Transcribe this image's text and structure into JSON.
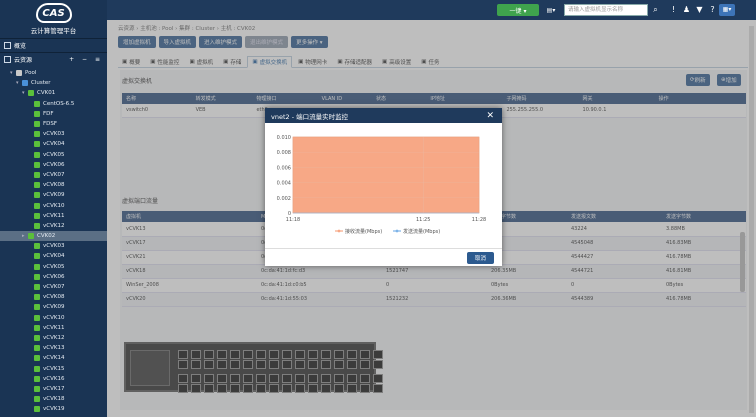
{
  "app": {
    "title": "云计算管理平台",
    "logo": "CAS"
  },
  "nav": {
    "overview": "概览",
    "resources": "云资源",
    "tools": "+ − ≡"
  },
  "tree": [
    {
      "label": "Pool",
      "level": 1,
      "type": "pool",
      "arrow": "▾"
    },
    {
      "label": "Cluster",
      "level": 2,
      "type": "cluster",
      "arrow": "▾"
    },
    {
      "label": "CVK01",
      "level": 3,
      "type": "host",
      "arrow": "▾"
    },
    {
      "label": "CentOS-6.5",
      "level": 4,
      "type": "vm"
    },
    {
      "label": "FDF",
      "level": 4,
      "type": "vm"
    },
    {
      "label": "FDSF",
      "level": 4,
      "type": "vm"
    },
    {
      "label": "vCVK03",
      "level": 4,
      "type": "vm"
    },
    {
      "label": "vCVK04",
      "level": 4,
      "type": "vm"
    },
    {
      "label": "vCVK05",
      "level": 4,
      "type": "vm"
    },
    {
      "label": "vCVK06",
      "level": 4,
      "type": "vm"
    },
    {
      "label": "vCVK07",
      "level": 4,
      "type": "vm"
    },
    {
      "label": "vCVK08",
      "level": 4,
      "type": "vm"
    },
    {
      "label": "vCVK09",
      "level": 4,
      "type": "vm"
    },
    {
      "label": "vCVK10",
      "level": 4,
      "type": "vm"
    },
    {
      "label": "vCVK11",
      "level": 4,
      "type": "vm"
    },
    {
      "label": "vCVK12",
      "level": 4,
      "type": "vm"
    },
    {
      "label": "CVK02",
      "level": 3,
      "type": "host",
      "arrow": "▸",
      "selected": true
    },
    {
      "label": "vCVK03",
      "level": 4,
      "type": "vm"
    },
    {
      "label": "vCVK04",
      "level": 4,
      "type": "vm"
    },
    {
      "label": "vCVK05",
      "level": 4,
      "type": "vm"
    },
    {
      "label": "vCVK06",
      "level": 4,
      "type": "vm"
    },
    {
      "label": "vCVK07",
      "level": 4,
      "type": "vm"
    },
    {
      "label": "vCVK08",
      "level": 4,
      "type": "vm"
    },
    {
      "label": "vCVK09",
      "level": 4,
      "type": "vm"
    },
    {
      "label": "vCVK10",
      "level": 4,
      "type": "vm"
    },
    {
      "label": "vCVK11",
      "level": 4,
      "type": "vm"
    },
    {
      "label": "vCVK12",
      "level": 4,
      "type": "vm"
    },
    {
      "label": "vCVK13",
      "level": 4,
      "type": "vm"
    },
    {
      "label": "vCVK14",
      "level": 4,
      "type": "vm"
    },
    {
      "label": "vCVK15",
      "level": 4,
      "type": "vm"
    },
    {
      "label": "vCVK16",
      "level": 4,
      "type": "vm"
    },
    {
      "label": "vCVK17",
      "level": 4,
      "type": "vm"
    },
    {
      "label": "vCVK18",
      "level": 4,
      "type": "vm"
    },
    {
      "label": "vCVK19",
      "level": 4,
      "type": "vm"
    }
  ],
  "topbar": {
    "green_btn": "一键 ▾",
    "search_placeholder": "请输入虚拟机显示名称"
  },
  "breadcrumb": "云资源 › 主机池 : Pool › 集群 : Cluster › 主机 : CVK02",
  "toolbar": [
    "增加虚拟机",
    "导入虚拟机",
    "进入维护模式",
    "退出维护模式",
    "更多操作 ▾"
  ],
  "tabs": [
    "概要",
    "性能监控",
    "虚拟机",
    "存储",
    "虚拟交换机",
    "物理网卡",
    "存储适配器",
    "高级设置",
    "任务"
  ],
  "vswitch": {
    "title": "虚拟交换机",
    "refresh": "刷新",
    "add": "增加",
    "headers": [
      "名称",
      "转发模式",
      "物理接口",
      "VLAN ID",
      "状态",
      "IP地址",
      "子网掩码",
      "网关",
      "操作"
    ],
    "rows": [
      [
        "vswitch0",
        "VEB",
        "eth0",
        "",
        "",
        "",
        "255.255.255.0",
        "10.90.0.1",
        ""
      ]
    ]
  },
  "vport": {
    "title": "虚拟端口流量",
    "headers": [
      "虚拟机",
      "MAC地址",
      "接收报文数",
      "接收字节数",
      "发送报文数",
      "发送字节数"
    ],
    "rows": [
      [
        "vCVK13",
        "0c:da:41:1d:...",
        "",
        "",
        "43224",
        "3.88MB"
      ],
      [
        "vCVK17",
        "0c:da:41:1d:...",
        "",
        "",
        "4545048",
        "416.83MB"
      ],
      [
        "vCVK21",
        "0c:da:41:1d:...",
        "",
        "",
        "4544427",
        "416.78MB"
      ],
      [
        "vCVK18",
        "0c:da:41:1d:fc:d3",
        "1521747",
        "206.35MB",
        "4544721",
        "416.81MB"
      ],
      [
        "WinSer_2008",
        "0c:da:41:1d:c0:b5",
        "0",
        "0Bytes",
        "0",
        "0Bytes"
      ],
      [
        "vCVK20",
        "0c:da:41:1d:55:03",
        "1521232",
        "206.36MB",
        "4544389",
        "416.78MB"
      ]
    ]
  },
  "modal": {
    "title": "vnet2 - 端口流量实时监控",
    "close": "✕",
    "cancel": "取消"
  },
  "chart_data": {
    "type": "area",
    "x": [
      "11:18",
      "11:25",
      "11:28"
    ],
    "series": [
      {
        "name": "接收流量(Mbps)",
        "values": [
          0.01,
          0.01,
          0.01
        ],
        "color": "#f7a886"
      },
      {
        "name": "发送流量(Mbps)",
        "values": [
          0,
          0,
          0
        ],
        "color": "#7fb4e8"
      }
    ],
    "yticks": [
      "0.010",
      "0.008",
      "0.006",
      "0.004",
      "0.002",
      "0"
    ],
    "ylim": [
      0,
      0.01
    ],
    "legend_position": "bottom"
  },
  "colors": {
    "sidebar": "#1a3454",
    "topbar": "#1f3a5c",
    "accent": "#2c5a8f",
    "green": "#3fa34d"
  }
}
